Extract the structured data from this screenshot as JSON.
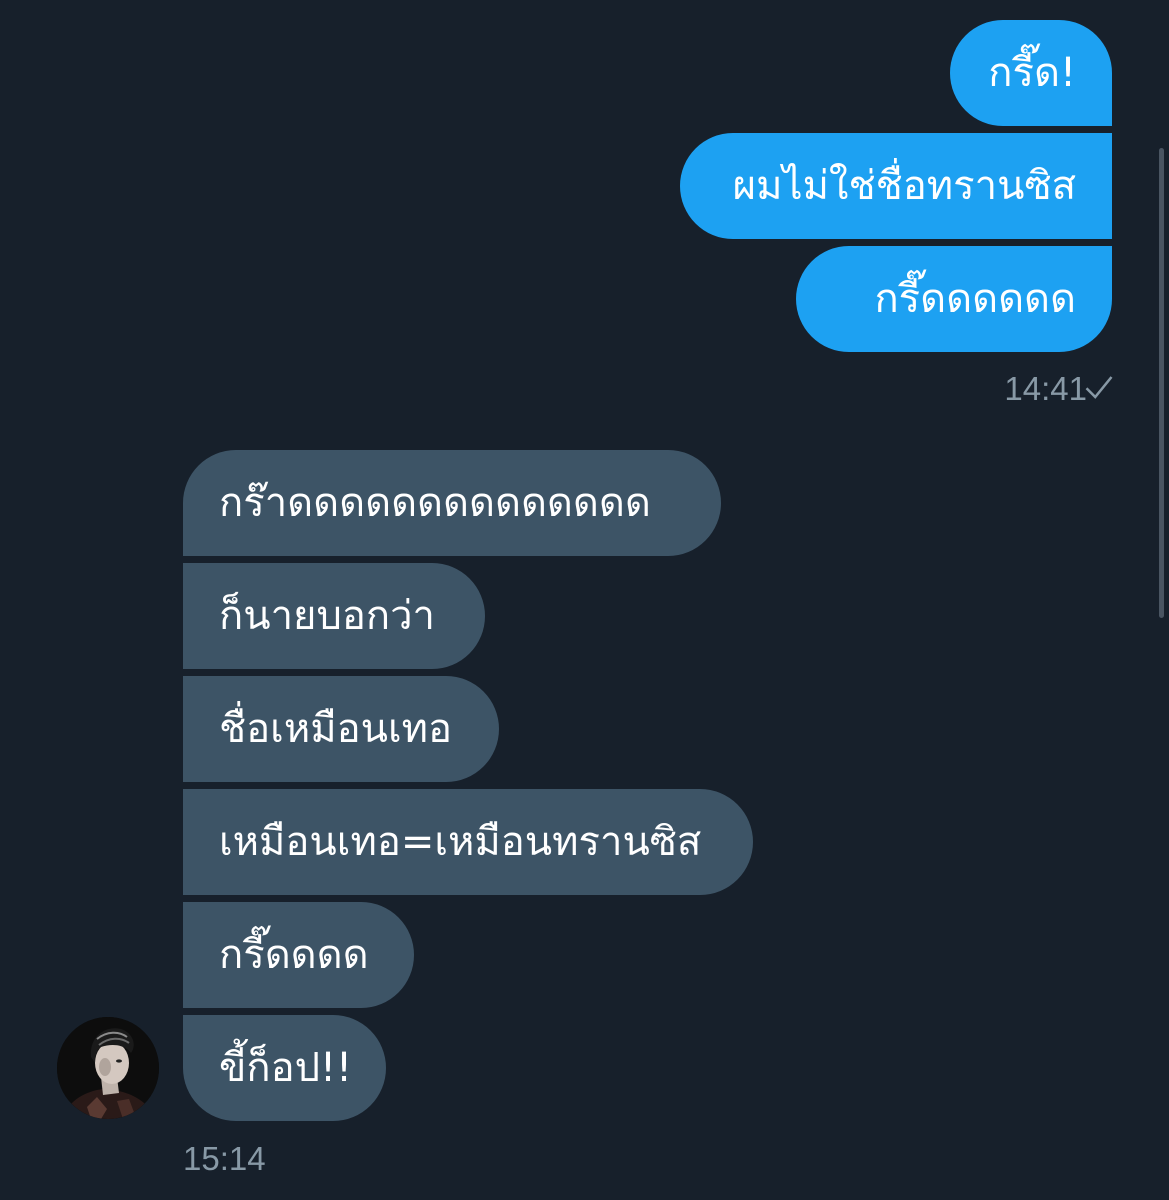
{
  "conversation": {
    "sent_messages": [
      "กรี๊ด!",
      "ผมไม่ใช่ชื่อทรานซิส",
      "กรี๊ดดดดดด"
    ],
    "sent_time": "14:41",
    "sent_status_icon": "checkmark-icon",
    "received_messages": [
      "กร๊าดดดดดดดดดดดดดด",
      "ก็นายบอกว่า",
      "ชื่อเหมือนเทอ",
      "เหมือนเทอ=เหมือนทรานซิส",
      "กรี๊ดดดด",
      "ขี้ก็อป!!"
    ],
    "received_time": "15:14",
    "sender_avatar_icon": "avatar-photo"
  },
  "colors": {
    "background": "#17202b",
    "sent_bubble": "#1da1f2",
    "received_bubble": "#3d5466",
    "timestamp": "#8899a6"
  }
}
